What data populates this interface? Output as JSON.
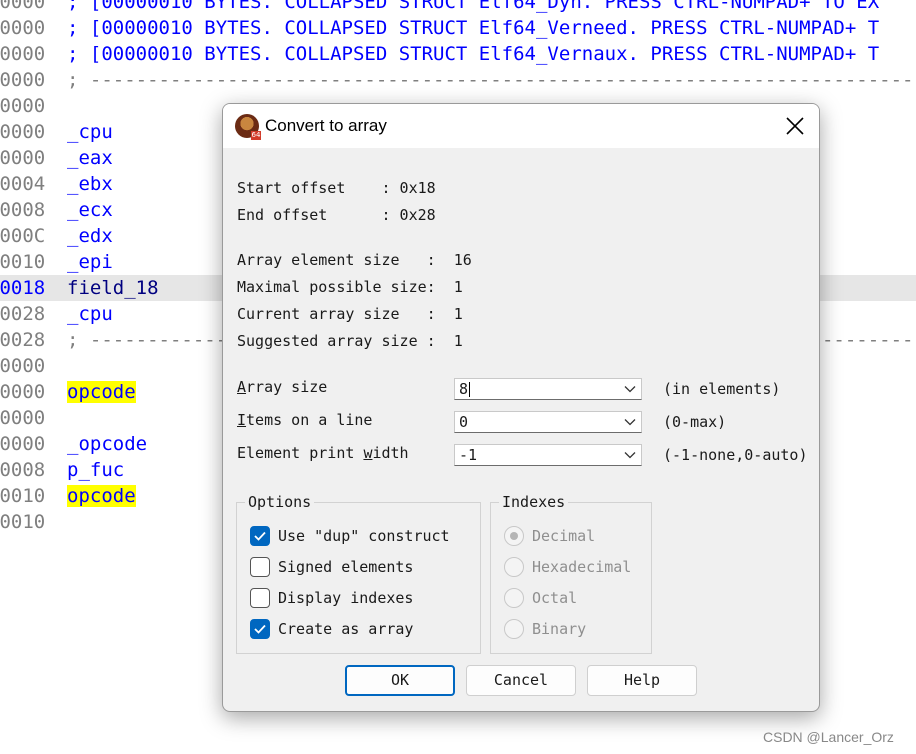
{
  "listing": [
    {
      "addr": "00000",
      "code": "; [00000010 BYTES. COLLAPSED STRUCT Elf64_Dyn. PRESS CTRL-NUMPAD+ TO EX",
      "style": "normal"
    },
    {
      "addr": "00000",
      "code": "; [00000010 BYTES. COLLAPSED STRUCT Elf64_Verneed. PRESS CTRL-NUMPAD+ T",
      "style": "normal"
    },
    {
      "addr": "00000",
      "code": "; [00000010 BYTES. COLLAPSED STRUCT Elf64_Vernaux. PRESS CTRL-NUMPAD+ T",
      "style": "normal"
    },
    {
      "addr": "00000",
      "code": "; ---------------------------------------------------------------------------",
      "style": "grey"
    },
    {
      "addr": "00000",
      "code": "",
      "style": "normal"
    },
    {
      "addr": "00000",
      "code": "_cpu",
      "style": "normal"
    },
    {
      "addr": "00000",
      "code": "_eax",
      "style": "normal"
    },
    {
      "addr": "00004",
      "code": "_ebx",
      "style": "normal"
    },
    {
      "addr": "00008",
      "code": "_ecx",
      "style": "normal"
    },
    {
      "addr": "0000C",
      "code": "_edx",
      "style": "normal"
    },
    {
      "addr": "00010",
      "code": "_epi",
      "style": "normal"
    },
    {
      "addr": "00018",
      "code": "field_18",
      "style": "selected"
    },
    {
      "addr": "00028",
      "code": "_cpu",
      "style": "normal"
    },
    {
      "addr": "00028",
      "code": "; ---------------------------------------------------------------------------",
      "style": "grey"
    },
    {
      "addr": "00000",
      "code": "",
      "style": "normal"
    },
    {
      "addr": "00000",
      "code": "opcode",
      "style": "yellow"
    },
    {
      "addr": "00000",
      "code": "",
      "style": "normal"
    },
    {
      "addr": "00000",
      "code": "_opcode",
      "style": "normal"
    },
    {
      "addr": "00008",
      "code": "p_fuc",
      "style": "normal"
    },
    {
      "addr": "00010",
      "code": "opcode",
      "style": "yellow"
    },
    {
      "addr": "00010",
      "code": "",
      "style": "normal"
    }
  ],
  "dialog": {
    "title": "Convert to array",
    "icon": "ida-app-icon",
    "badge": "64",
    "info": [
      "Start offset    : 0x18",
      "End offset      : 0x28",
      "Array element size   :  16",
      "Maximal possible size:  1",
      "Current array size   :  1",
      "Suggested array size :  1"
    ],
    "fields": {
      "array_size": {
        "hotkey": "A",
        "rest": "rray size",
        "value": "8",
        "hint": "(in elements)"
      },
      "items_on_line": {
        "hotkey": "I",
        "rest": "tems on a line",
        "value": "0",
        "hint": "(0-max)"
      },
      "element_width": {
        "prefix": "Element print ",
        "hotkey": "w",
        "rest": "idth",
        "value": "-1",
        "hint": "(-1-none,0-auto)"
      }
    },
    "options": {
      "title": "Options",
      "items": [
        {
          "label": "Use \"dup\" construct",
          "checked": true
        },
        {
          "label": "Signed elements",
          "checked": false
        },
        {
          "label": "Display indexes",
          "checked": false
        },
        {
          "label": "Create as array",
          "checked": true
        }
      ]
    },
    "indexes": {
      "title": "Indexes",
      "items": [
        {
          "label": "Decimal",
          "selected": true
        },
        {
          "label": "Hexadecimal",
          "selected": false
        },
        {
          "label": "Octal",
          "selected": false
        },
        {
          "label": "Binary",
          "selected": false
        }
      ]
    },
    "buttons": {
      "ok": "OK",
      "cancel": "Cancel",
      "help": "Help"
    }
  },
  "watermark": "CSDN @Lancer_Orz",
  "colors": {
    "accent": "#0067c0",
    "code_blue": "#0000ff",
    "highlight_yellow": "#ffff00"
  }
}
